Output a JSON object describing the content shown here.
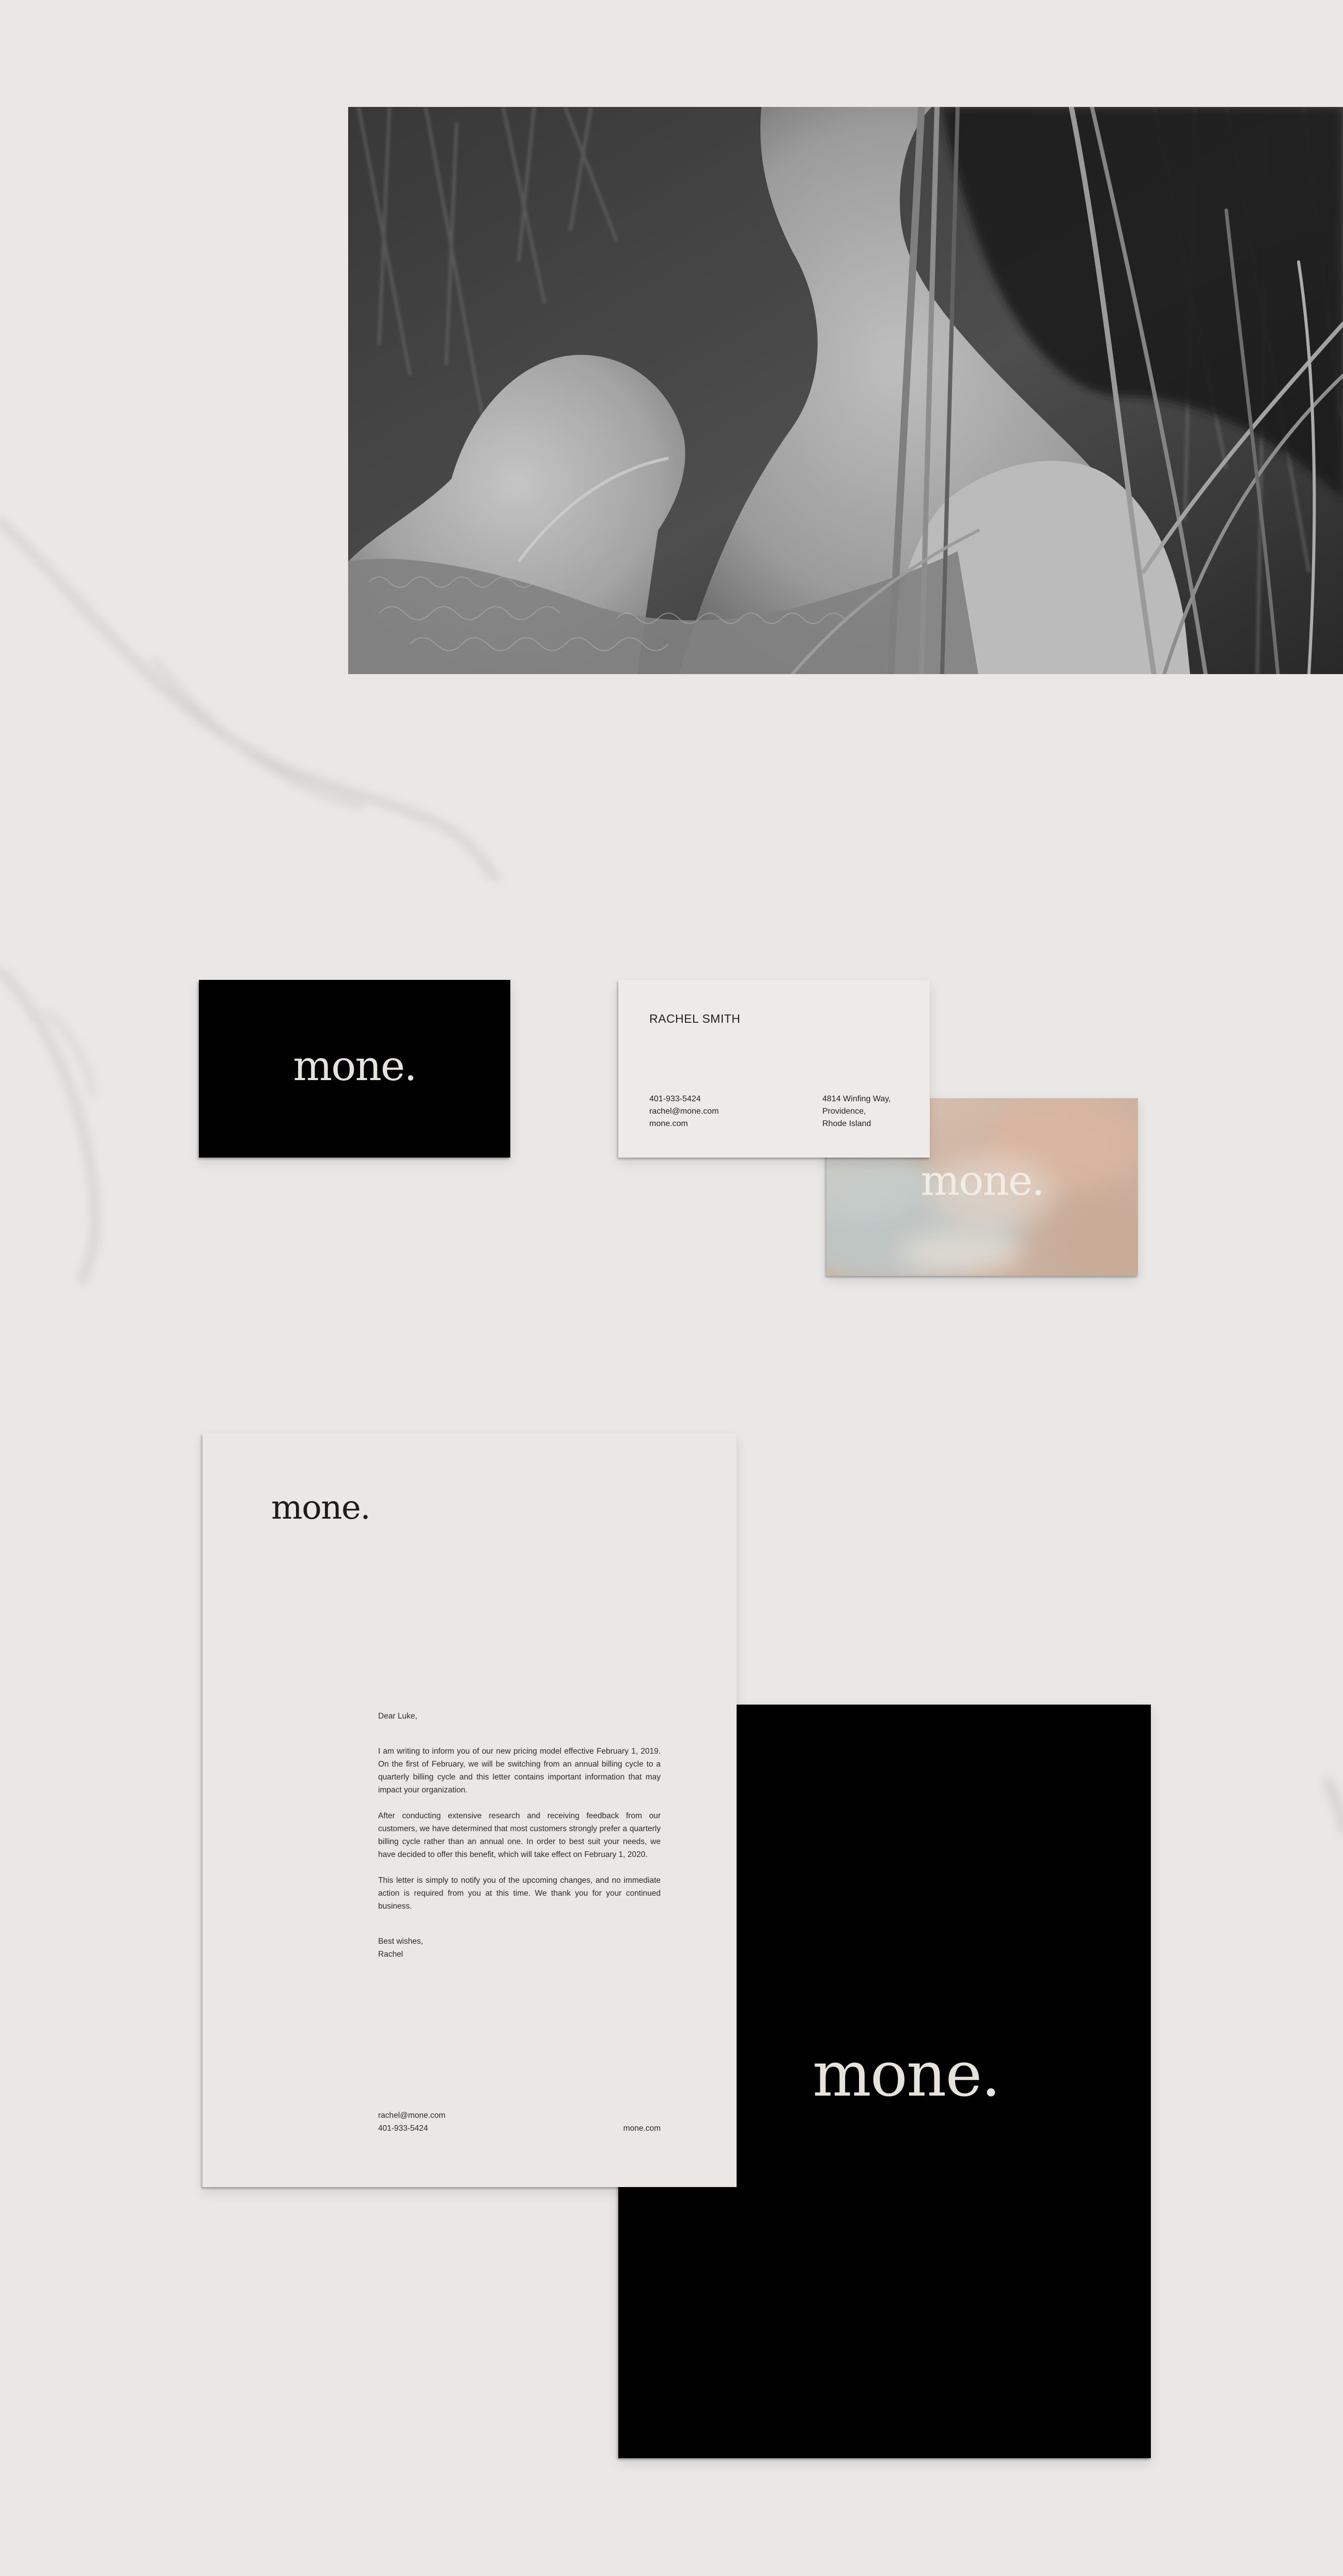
{
  "brand": {
    "logo_text": "mone."
  },
  "hero": {
    "icon": "monochrome-portrait-photo"
  },
  "business_card_contact": {
    "name": "RACHEL SMITH",
    "phone": "401-933-5424",
    "email": "rachel@mone.com",
    "website": "mone.com",
    "address_line1": "4814 Winfing Way,",
    "address_line2": "Providence,",
    "address_line3": "Rhode Island"
  },
  "letter": {
    "greeting": "Dear Luke,",
    "paragraphs": [
      "I am writing to inform you of our new pricing model effective February 1, 2019. On the first of February, we will be switching from an annual billing cycle to a quarterly billing cycle and this letter contains important information that may impact your organization.",
      "After conducting extensive research and receiving feedback from our customers, we have determined that most customers strongly prefer a quarterly billing cycle rather than an annual one. In order to best suit your needs, we have decided to offer this benefit, which will take effect on February 1, 2020.",
      "This letter is simply to notify you of the upcoming changes, and no immediate action is required from you at this time. We thank you for your continued business."
    ],
    "signoff": "Best wishes,",
    "signature": "Rachel",
    "footer_email": "rachel@mone.com",
    "footer_phone": "401-933-5424",
    "footer_website": "mone.com"
  },
  "colors": {
    "background": "#e9e8e6",
    "black_card": "#000000",
    "paper": "#ebe7e4",
    "logo_light": "#e6e2dc",
    "texture_peach": "#d4b8a5",
    "texture_blue": "#b8c4c6"
  }
}
